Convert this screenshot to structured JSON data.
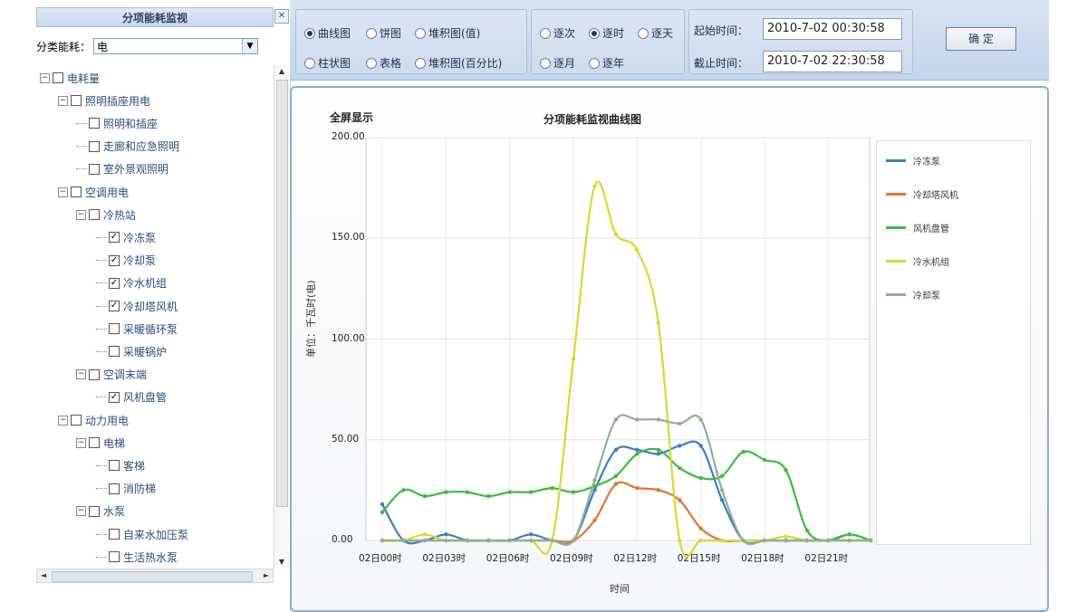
{
  "left_panel": {
    "title": "分项能耗监视",
    "close_glyph": "✕",
    "filter_label": "分类能耗：",
    "filter_value": "电",
    "tree": [
      {
        "label": "电耗量",
        "level": 0,
        "toggle": "⊟",
        "checked": false
      },
      {
        "label": "照明插座用电",
        "level": 1,
        "toggle": "⊟",
        "checked": false
      },
      {
        "label": "照明和插座",
        "level": 2,
        "toggle": "",
        "checked": false
      },
      {
        "label": "走廊和应急照明",
        "level": 2,
        "toggle": "",
        "checked": false
      },
      {
        "label": "室外景观照明",
        "level": 2,
        "toggle": "",
        "checked": false
      },
      {
        "label": "空调用电",
        "level": 1,
        "toggle": "⊟",
        "checked": false
      },
      {
        "label": "冷热站",
        "level": 2,
        "toggle": "⊟",
        "checked": false
      },
      {
        "label": "冷冻泵",
        "level": 3,
        "toggle": "",
        "checked": true
      },
      {
        "label": "冷却泵",
        "level": 3,
        "toggle": "",
        "checked": true
      },
      {
        "label": "冷水机组",
        "level": 3,
        "toggle": "",
        "checked": true
      },
      {
        "label": "冷却塔风机",
        "level": 3,
        "toggle": "",
        "checked": true
      },
      {
        "label": "采暖循环泵",
        "level": 3,
        "toggle": "",
        "checked": false
      },
      {
        "label": "采暖锅炉",
        "level": 3,
        "toggle": "",
        "checked": false
      },
      {
        "label": "空调末端",
        "level": 2,
        "toggle": "⊟",
        "checked": false
      },
      {
        "label": "风机盘管",
        "level": 3,
        "toggle": "",
        "checked": true
      },
      {
        "label": "动力用电",
        "level": 1,
        "toggle": "⊟",
        "checked": false
      },
      {
        "label": "电梯",
        "level": 2,
        "toggle": "⊟",
        "checked": false
      },
      {
        "label": "客梯",
        "level": 3,
        "toggle": "",
        "checked": false
      },
      {
        "label": "消防梯",
        "level": 3,
        "toggle": "",
        "checked": false
      },
      {
        "label": "水泵",
        "level": 2,
        "toggle": "⊟",
        "checked": false
      },
      {
        "label": "自来水加压泵",
        "level": 3,
        "toggle": "",
        "checked": false
      },
      {
        "label": "生活热水泵",
        "level": 3,
        "toggle": "",
        "checked": false
      }
    ]
  },
  "toolbar": {
    "chart_types": [
      {
        "label": "曲线图",
        "selected": true
      },
      {
        "label": "饼图",
        "selected": false
      },
      {
        "label": "堆积图(值)",
        "selected": false
      },
      {
        "label": "柱状图",
        "selected": false
      },
      {
        "label": "表格",
        "selected": false
      },
      {
        "label": "堆积图(百分比)",
        "selected": false
      }
    ],
    "granularity": [
      {
        "label": "逐次",
        "selected": false
      },
      {
        "label": "逐时",
        "selected": true
      },
      {
        "label": "逐天",
        "selected": false
      },
      {
        "label": "逐月",
        "selected": false
      },
      {
        "label": "逐年",
        "selected": false
      }
    ],
    "start_label": "起始时间：",
    "start_value": "2010-7-02 00:30:58",
    "end_label": "截止时间：",
    "end_value": "2010-7-02 22:30:58",
    "confirm_label": "确 定"
  },
  "chart_header": {
    "fullscreen_label": "全屏显示"
  },
  "chart_data": {
    "type": "line",
    "title": "分项能耗监视曲线图",
    "xlabel": "时间",
    "ylabel": "单位：千瓦时(电)",
    "ylim": [
      0,
      200
    ],
    "yticks": [
      "0.00",
      "50.00",
      "100.00",
      "150.00",
      "200.00"
    ],
    "x": [
      0,
      1,
      2,
      3,
      4,
      5,
      6,
      7,
      8,
      9,
      10,
      11,
      12,
      13,
      14,
      15,
      16,
      17,
      18,
      19,
      20,
      21,
      22,
      23
    ],
    "xticks": [
      {
        "x": 0,
        "label": "02日00时"
      },
      {
        "x": 3,
        "label": "02日03时"
      },
      {
        "x": 6,
        "label": "02日06时"
      },
      {
        "x": 9,
        "label": "02日09时"
      },
      {
        "x": 12,
        "label": "02日12时"
      },
      {
        "x": 15,
        "label": "02日15时"
      },
      {
        "x": 18,
        "label": "02日18时"
      },
      {
        "x": 21,
        "label": "02日21时"
      }
    ],
    "grid": true,
    "legend_position": "right",
    "series": [
      {
        "name": "冷冻泵",
        "color": "#3a7fc4",
        "values": [
          18,
          0,
          0,
          3,
          0,
          0,
          0,
          3,
          0,
          0,
          25,
          45,
          45,
          43,
          47,
          47,
          20,
          0,
          0,
          0,
          0,
          0,
          3,
          0
        ]
      },
      {
        "name": "冷却塔风机",
        "color": "#e4742f",
        "values": [
          0,
          0,
          0,
          0,
          0,
          0,
          0,
          0,
          0,
          0,
          10,
          28,
          26,
          25,
          20,
          6,
          0,
          0,
          0,
          0,
          0,
          0,
          0,
          0
        ]
      },
      {
        "name": "风机盘管",
        "color": "#3dbb3d",
        "values": [
          14,
          25,
          22,
          24,
          24,
          22,
          24,
          24,
          26,
          24,
          27,
          32,
          43,
          45,
          36,
          31,
          32,
          44,
          40,
          35,
          5,
          0,
          3,
          0
        ]
      },
      {
        "name": "冷水机组",
        "color": "#d9d92f",
        "values": [
          0,
          0,
          3,
          0,
          0,
          0,
          0,
          0,
          0,
          90,
          176,
          152,
          144,
          108,
          0,
          0,
          0,
          0,
          0,
          2,
          0,
          0,
          0,
          0
        ]
      },
      {
        "name": "冷却泵",
        "color": "#8fb08f",
        "values": [
          0,
          0,
          0,
          0,
          0,
          0,
          0,
          0,
          0,
          0,
          30,
          60,
          60,
          60,
          58,
          60,
          25,
          0,
          0,
          0,
          0,
          0,
          0,
          0
        ]
      }
    ]
  }
}
